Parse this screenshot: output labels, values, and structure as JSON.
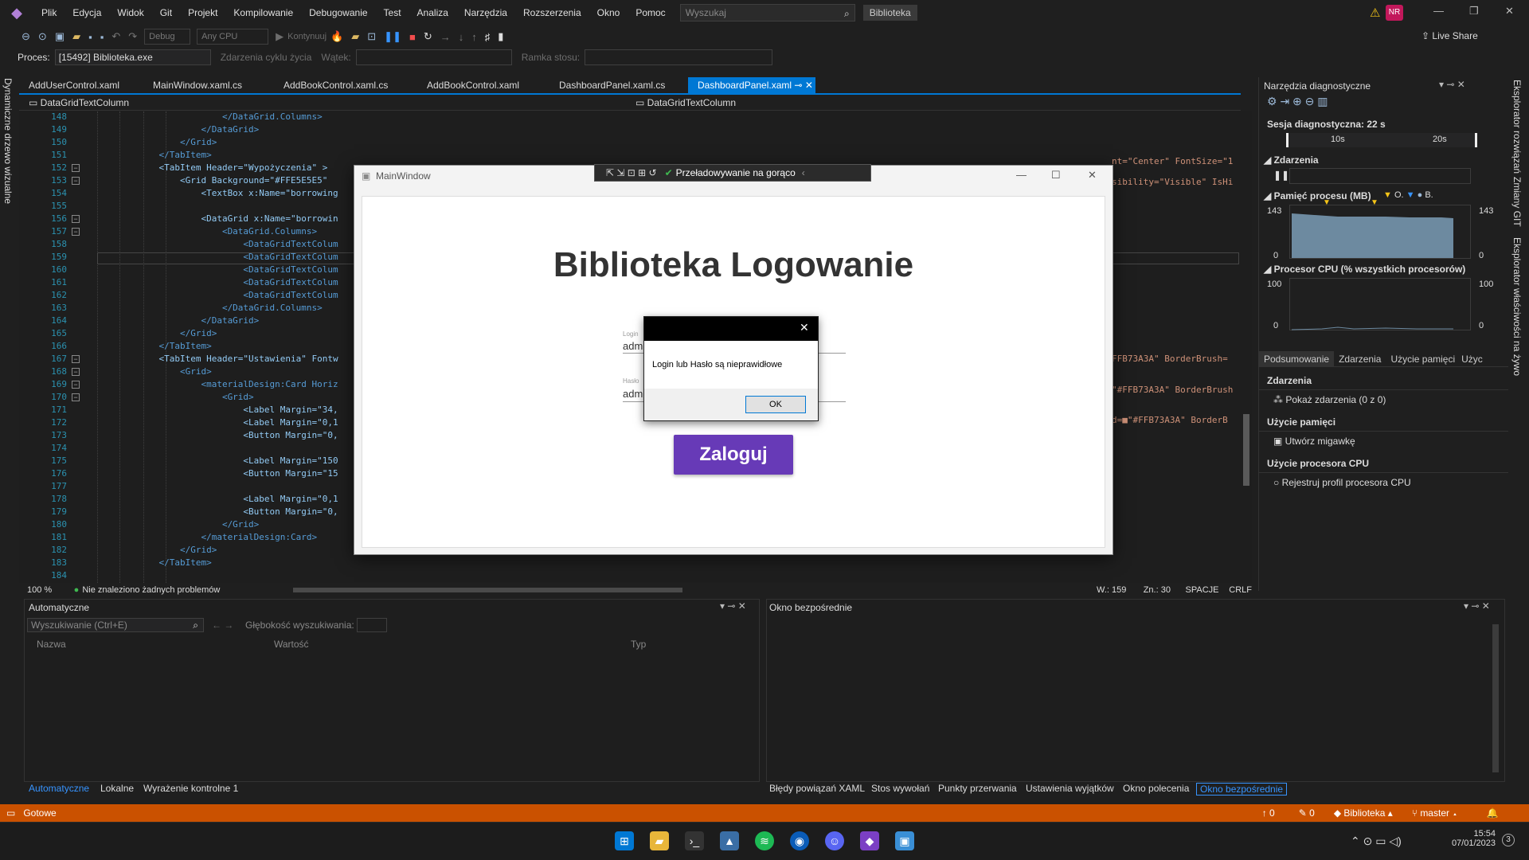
{
  "menubar": {
    "items": [
      "Plik",
      "Edycja",
      "Widok",
      "Git",
      "Projekt",
      "Kompilowanie",
      "Debugowanie",
      "Test",
      "Analiza",
      "Narzędzia",
      "Rozszerzenia",
      "Okno",
      "Pomoc"
    ],
    "search_placeholder": "Wyszukaj",
    "solution": "Biblioteka",
    "avatar": "NR"
  },
  "toolbar": {
    "config": "Debug",
    "platform": "Any CPU",
    "continue": "Kontynuuj",
    "live_share": "Live Share"
  },
  "procbar": {
    "label": "Proces:",
    "value": "[15492] Biblioteka.exe",
    "lifecycle": "Zdarzenia cyklu życia",
    "thread": "Wątek:",
    "stack": "Ramka stosu:"
  },
  "left_tool": "Dynamiczne drzewo wizualne",
  "right_tools": [
    "Eksplorator rozwiązań",
    "Zmiany GIT",
    "Eksplorator właściwości na żywo"
  ],
  "tabs": [
    "AddUserControl.xaml",
    "MainWindow.xaml.cs",
    "AddBookControl.xaml.cs",
    "AddBookControl.xaml",
    "DashboardPanel.xaml.cs",
    "DashboardPanel.xaml"
  ],
  "navbar": {
    "left": "DataGridTextColumn",
    "right": "DataGridTextColumn"
  },
  "code_lines": [
    {
      "n": "148",
      "t": "                        </DataGrid.Columns>"
    },
    {
      "n": "149",
      "t": "                    </DataGrid>"
    },
    {
      "n": "150",
      "t": "                </Grid>"
    },
    {
      "n": "151",
      "t": "            </TabItem>"
    },
    {
      "n": "152",
      "t": "            <TabItem Header=\"Wypożyczenia\" >"
    },
    {
      "n": "153",
      "t": "                <Grid Background=\"#FFE5E5E5\""
    },
    {
      "n": "154",
      "t": "                    <TextBox x:Name=\"borrowing"
    },
    {
      "n": "155",
      "t": ""
    },
    {
      "n": "156",
      "t": "                    <DataGrid x:Name=\"borrowin"
    },
    {
      "n": "157",
      "t": "                        <DataGrid.Columns>"
    },
    {
      "n": "158",
      "t": "                            <DataGridTextColum"
    },
    {
      "n": "159",
      "t": "                            <DataGridTextColum"
    },
    {
      "n": "160",
      "t": "                            <DataGridTextColum"
    },
    {
      "n": "161",
      "t": "                            <DataGridTextColum"
    },
    {
      "n": "162",
      "t": "                            <DataGridTextColum"
    },
    {
      "n": "163",
      "t": "                        </DataGrid.Columns>"
    },
    {
      "n": "164",
      "t": "                    </DataGrid>"
    },
    {
      "n": "165",
      "t": "                </Grid>"
    },
    {
      "n": "166",
      "t": "            </TabItem>"
    },
    {
      "n": "167",
      "t": "            <TabItem Header=\"Ustawienia\" Fontw"
    },
    {
      "n": "168",
      "t": "                <Grid>"
    },
    {
      "n": "169",
      "t": "                    <materialDesign:Card Horiz"
    },
    {
      "n": "170",
      "t": "                        <Grid>"
    },
    {
      "n": "171",
      "t": "                            <Label Margin=\"34,"
    },
    {
      "n": "172",
      "t": "                            <Label Margin=\"0,1"
    },
    {
      "n": "173",
      "t": "                            <Button Margin=\"0,"
    },
    {
      "n": "174",
      "t": ""
    },
    {
      "n": "175",
      "t": "                            <Label Margin=\"150"
    },
    {
      "n": "176",
      "t": "                            <Button Margin=\"15"
    },
    {
      "n": "177",
      "t": ""
    },
    {
      "n": "178",
      "t": "                            <Label Margin=\"0,1"
    },
    {
      "n": "179",
      "t": "                            <Button Margin=\"0,"
    },
    {
      "n": "180",
      "t": "                        </Grid>"
    },
    {
      "n": "181",
      "t": "                    </materialDesign:Card>"
    },
    {
      "n": "182",
      "t": "                </Grid>"
    },
    {
      "n": "183",
      "t": "            </TabItem>"
    },
    {
      "n": "184",
      "t": ""
    }
  ],
  "code_right": [
    {
      "t": "nt=\"Center\" FontSize=\"1"
    },
    {
      "t": "sibility=\"Visible\" IsHi"
    },
    {
      "t": "FFB73A3A\" BorderBrush="
    },
    {
      "t": "\"#FFB73A3A\" BorderBrush"
    },
    {
      "t": "d=■\"#FFB73A3A\" BorderB"
    }
  ],
  "editor_status": {
    "zoom": "100 %",
    "issues": "Nie znaleziono żadnych problemów",
    "line": "W.: 159",
    "col": "Zn.: 30",
    "spaces": "SPACJE",
    "eol": "CRLF"
  },
  "diag": {
    "title": "Narzędzia diagnostyczne",
    "session": "Sesja diagnostyczna: 22 s",
    "tick1": "10s",
    "tick2": "20s",
    "events": "Zdarzenia",
    "memory": "Pamięć procesu (MB)",
    "mem_legend1": "O.",
    "mem_legend2": "B.",
    "mem_max": "143",
    "mem_min": "0",
    "cpu": "Procesor CPU (% wszystkich procesorów)",
    "cpu_max": "100",
    "cpu_min": "0",
    "tabs": [
      "Podsumowanie",
      "Zdarzenia",
      "Użycie pamięci",
      "Użyc"
    ],
    "sec_events": "Zdarzenia",
    "show_events": "Pokaż zdarzenia (0 z 0)",
    "sec_mem": "Użycie pamięci",
    "snapshot": "Utwórz migawkę",
    "sec_cpu": "Użycie procesora CPU",
    "record_cpu": "Rejestruj profil procesora CPU"
  },
  "autos": {
    "title": "Automatyczne",
    "search_placeholder": "Wyszukiwanie (Ctrl+E)",
    "depth": "Głębokość wyszukiwania:",
    "col_name": "Nazwa",
    "col_value": "Wartość",
    "col_type": "Typ",
    "tabs": [
      "Automatyczne",
      "Lokalne",
      "Wyrażenie kontrolne 1"
    ]
  },
  "immediate": {
    "title": "Okno bezpośrednie",
    "tabs": [
      "Błędy powiązań XAML",
      "Stos wywołań",
      "Punkty przerwania",
      "Ustawienia wyjątków",
      "Okno polecenia",
      "Okno bezpośrednie"
    ]
  },
  "statusbar": {
    "ready": "Gotowe",
    "up": "0",
    "pencil": "0",
    "repo": "Biblioteka",
    "branch": "master"
  },
  "app": {
    "title": "MainWindow",
    "hot_reload": "Przeładowywanie na gorąco",
    "heading": "Biblioteka Logowanie",
    "login_label": "Login",
    "login_value": "adm",
    "pass_label": "Hasło",
    "pass_value": "adm",
    "button": "Zaloguj"
  },
  "dialog": {
    "message": "Login lub Hasło są nieprawidłowe",
    "ok": "OK"
  },
  "taskbar": {
    "time": "15:54",
    "date": "07/01/2023",
    "notif": "3"
  },
  "colors": {
    "accent": "#0078d4",
    "status": "#ca5100",
    "button": "#673ab7"
  }
}
